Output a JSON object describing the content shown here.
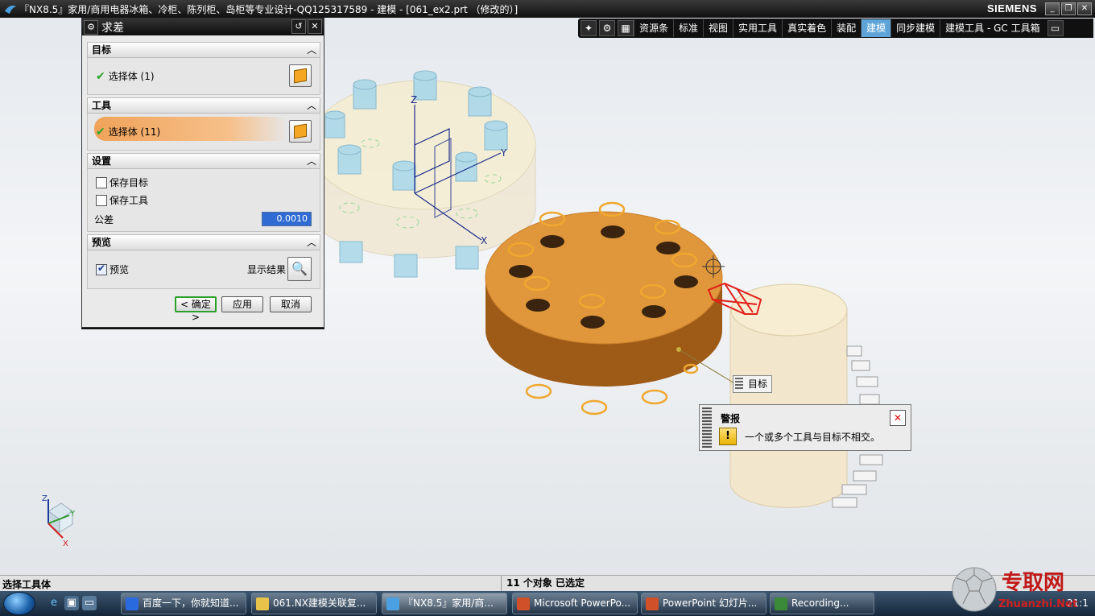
{
  "titlebar": {
    "title": "『NX8.5』家用/商用电器冰箱、冷柜、陈列柜、岛柜等专业设计-QQ125317589 - 建模 - [061_ex2.prt （修改的）]",
    "brand": "SIEMENS"
  },
  "ribbon": {
    "tabs": [
      "资源条",
      "标准",
      "视图",
      "实用工具",
      "真实着色",
      "装配",
      "建模",
      "同步建模",
      "建模工具 - GC 工具箱"
    ],
    "active_tab": "建模",
    "active_color": "#5fa4d8"
  },
  "dialog": {
    "title": "求差",
    "sections": {
      "target": {
        "label": "目标",
        "select_label": "选择体 (1)"
      },
      "tool": {
        "label": "工具",
        "select_label": "选择体 (11)"
      },
      "settings": {
        "label": "设置",
        "keep_target": "保存目标",
        "keep_tool": "保存工具",
        "tolerance_label": "公差",
        "tolerance_value": "0.0010"
      },
      "preview": {
        "label": "预览",
        "preview_check": "预览",
        "show_result": "显示结果"
      }
    },
    "buttons": {
      "ok": "< 确定 >",
      "apply": "应用",
      "cancel": "取消"
    }
  },
  "canvas": {
    "axis_labels": {
      "z": "Z",
      "y": "Y",
      "x": "X"
    },
    "target_tag": "目标",
    "alert": {
      "title": "警报",
      "message": "一个或多个工具与目标不相交。"
    },
    "colors": {
      "orange": "#e0963a",
      "body_brown": "#b5651d",
      "cylinder_blue": "#9ed3e6",
      "selection_red": "#e0201a"
    }
  },
  "statusbar": {
    "left": "选择工具体",
    "middle": "11 个对象 已选定"
  },
  "taskbar": {
    "items": [
      {
        "label": "百度一下，你就知道..."
      },
      {
        "label": "061.NX建模关联复..."
      },
      {
        "label": "『NX8.5』家用/商..."
      },
      {
        "label": "Microsoft PowerPo..."
      },
      {
        "label": "PowerPoint 幻灯片..."
      },
      {
        "label": "Recording..."
      }
    ],
    "time": "21:1"
  },
  "watermark": {
    "text": "专取网",
    "url": "Zhuanzhi.Net"
  }
}
